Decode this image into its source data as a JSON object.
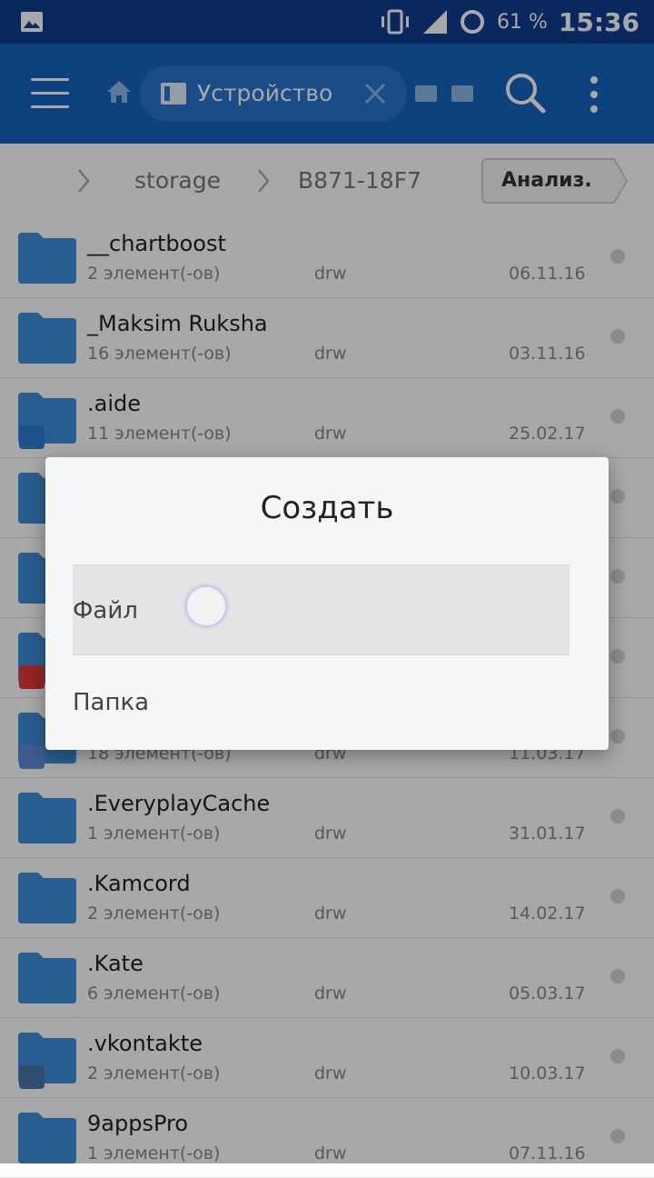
{
  "status_bar": {
    "battery_percent": "61 %",
    "time": "15:36"
  },
  "toolbar": {
    "location_label": "Устройство"
  },
  "breadcrumb": {
    "items": [
      "storage",
      "B871-18F7"
    ],
    "analyze_label": "Анализ."
  },
  "files": [
    {
      "name": "__chartboost",
      "meta": "2 элемент(-ов)",
      "perm": "drw",
      "date": "06.11.16",
      "badge": ""
    },
    {
      "name": "_Maksim Ruksha",
      "meta": "16 элемент(-ов)",
      "perm": "drw",
      "date": "03.11.16",
      "badge": ""
    },
    {
      "name": ".aide",
      "meta": "11 элемент(-ов)",
      "perm": "drw",
      "date": "25.02.17",
      "badge": "android-icon"
    },
    {
      "name": "",
      "meta": "",
      "perm": "",
      "date": "",
      "badge": ""
    },
    {
      "name": "",
      "meta": "",
      "perm": "",
      "date": "",
      "badge": ""
    },
    {
      "name": "",
      "meta": "",
      "perm": "",
      "date": "",
      "badge": "shop-bag-icon"
    },
    {
      "name": "",
      "meta": "18 элемент(-ов)",
      "perm": "drw",
      "date": "11.03.17",
      "badge": "fi-icon"
    },
    {
      "name": ".EveryplayCache",
      "meta": "1 элемент(-ов)",
      "perm": "drw",
      "date": "31.01.17",
      "badge": ""
    },
    {
      "name": ".Kamcord",
      "meta": "2 элемент(-ов)",
      "perm": "drw",
      "date": "14.02.17",
      "badge": ""
    },
    {
      "name": ".Kate",
      "meta": "6 элемент(-ов)",
      "perm": "drw",
      "date": "05.03.17",
      "badge": ""
    },
    {
      "name": ".vkontakte",
      "meta": "2 элемент(-ов)",
      "perm": "drw",
      "date": "10.03.17",
      "badge": "vk-icon"
    },
    {
      "name": "9appsPro",
      "meta": "1 элемент(-ов)",
      "perm": "drw",
      "date": "07.11.16",
      "badge": ""
    }
  ],
  "dialog": {
    "title": "Создать",
    "option_file": "Файл",
    "option_folder": "Папка"
  },
  "colors": {
    "statusbar": "#0f3d8d",
    "toolbar": "#1565c0",
    "folder": "#3f8fde",
    "dialog_bg": "#f5f6f8"
  }
}
